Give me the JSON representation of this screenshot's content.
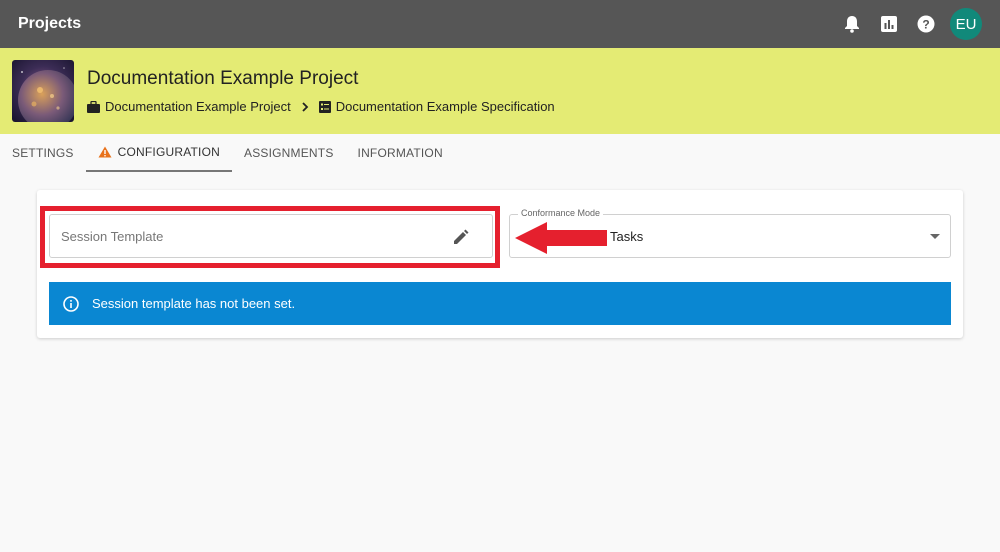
{
  "topbar": {
    "title": "Projects",
    "icons": [
      "bell-icon",
      "chart-icon",
      "help-icon"
    ],
    "avatar_initials": "EU"
  },
  "header": {
    "project_title": "Documentation Example Project",
    "breadcrumb": {
      "project": "Documentation Example Project",
      "specification": "Documentation Example Specification"
    }
  },
  "tabs": [
    {
      "label": "SETTINGS",
      "active": false
    },
    {
      "label": "CONFIGURATION",
      "active": true,
      "warning": true
    },
    {
      "label": "ASSIGNMENTS",
      "active": false
    },
    {
      "label": "INFORMATION",
      "active": false
    }
  ],
  "form": {
    "session_template_placeholder": "Session Template",
    "conformance_label": "Conformance Mode",
    "conformance_value": "Tasks"
  },
  "alert": {
    "message": "Session template has not been set."
  },
  "colors": {
    "topbar": "#565656",
    "header": "#e4eb74",
    "avatar": "#11897a",
    "alert": "#0a87d2",
    "highlight": "#e5202e",
    "warning": "#e8721c"
  }
}
